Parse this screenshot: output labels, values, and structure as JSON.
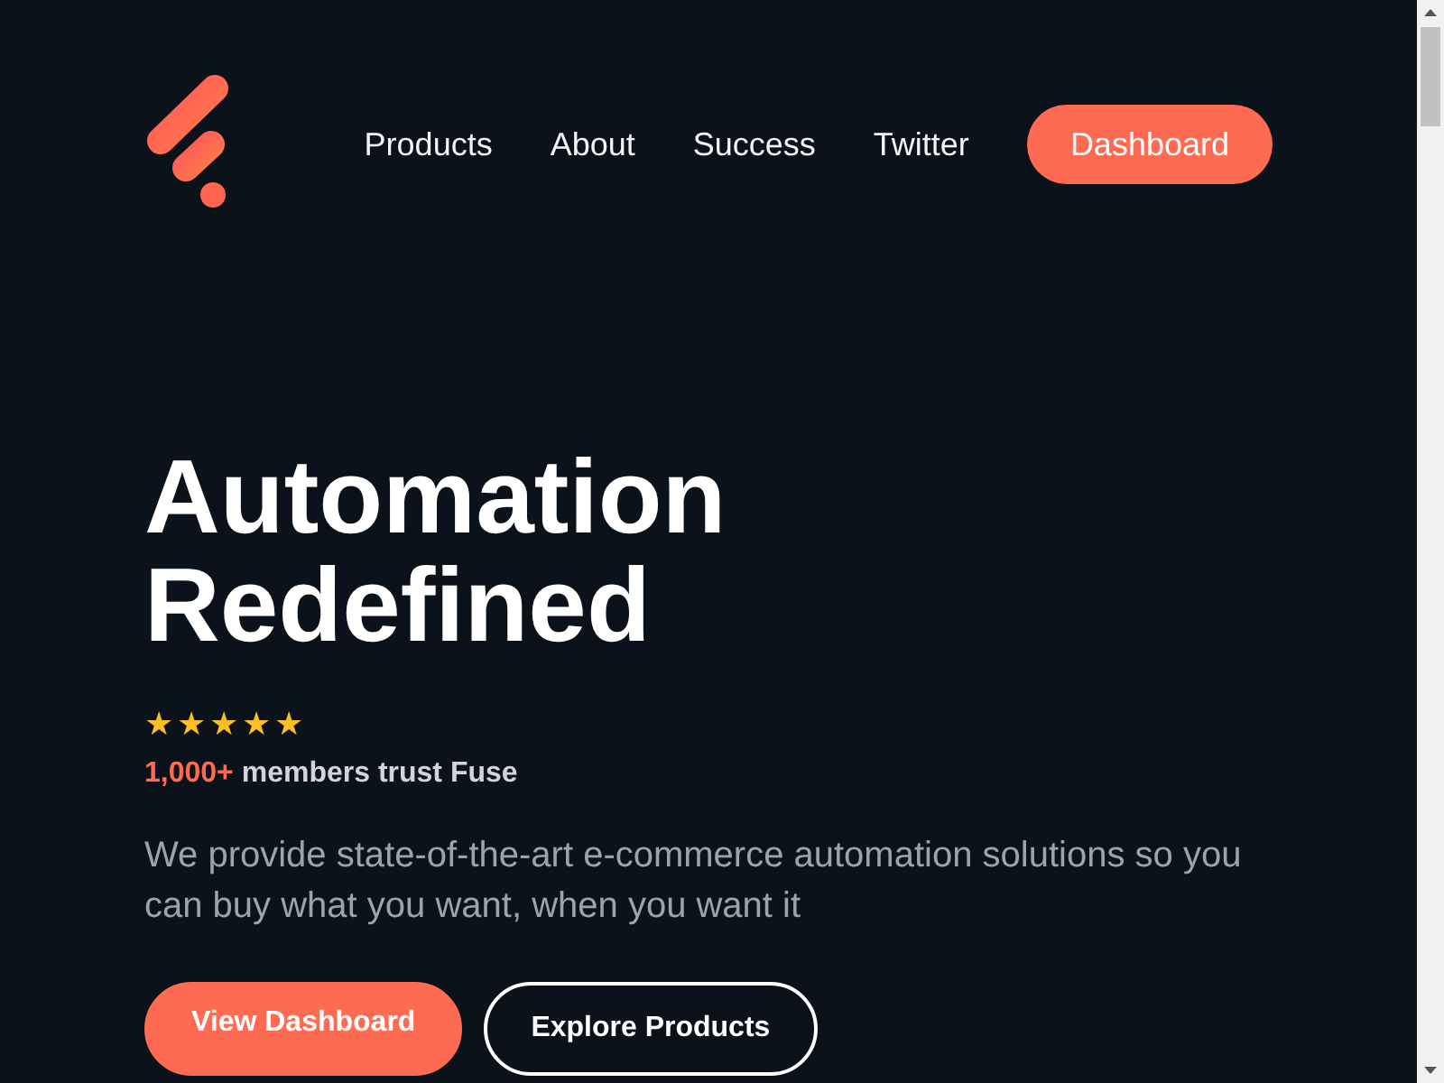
{
  "nav": {
    "links": [
      {
        "label": "Products"
      },
      {
        "label": "About"
      },
      {
        "label": "Success"
      },
      {
        "label": "Twitter"
      }
    ],
    "cta": "Dashboard"
  },
  "hero": {
    "title_lines": [
      "Automation",
      "Redefined"
    ],
    "rating": {
      "stars": 5
    },
    "trust": {
      "count": "1,000+",
      "text": "members trust Fuse"
    },
    "description": "We provide state-of-the-art e-commerce automation solutions so you can buy what you want, when you want it",
    "buttons": [
      {
        "label": "View Dashboard",
        "kind": "primary"
      },
      {
        "label": "Explore Products",
        "kind": "outline"
      }
    ]
  }
}
